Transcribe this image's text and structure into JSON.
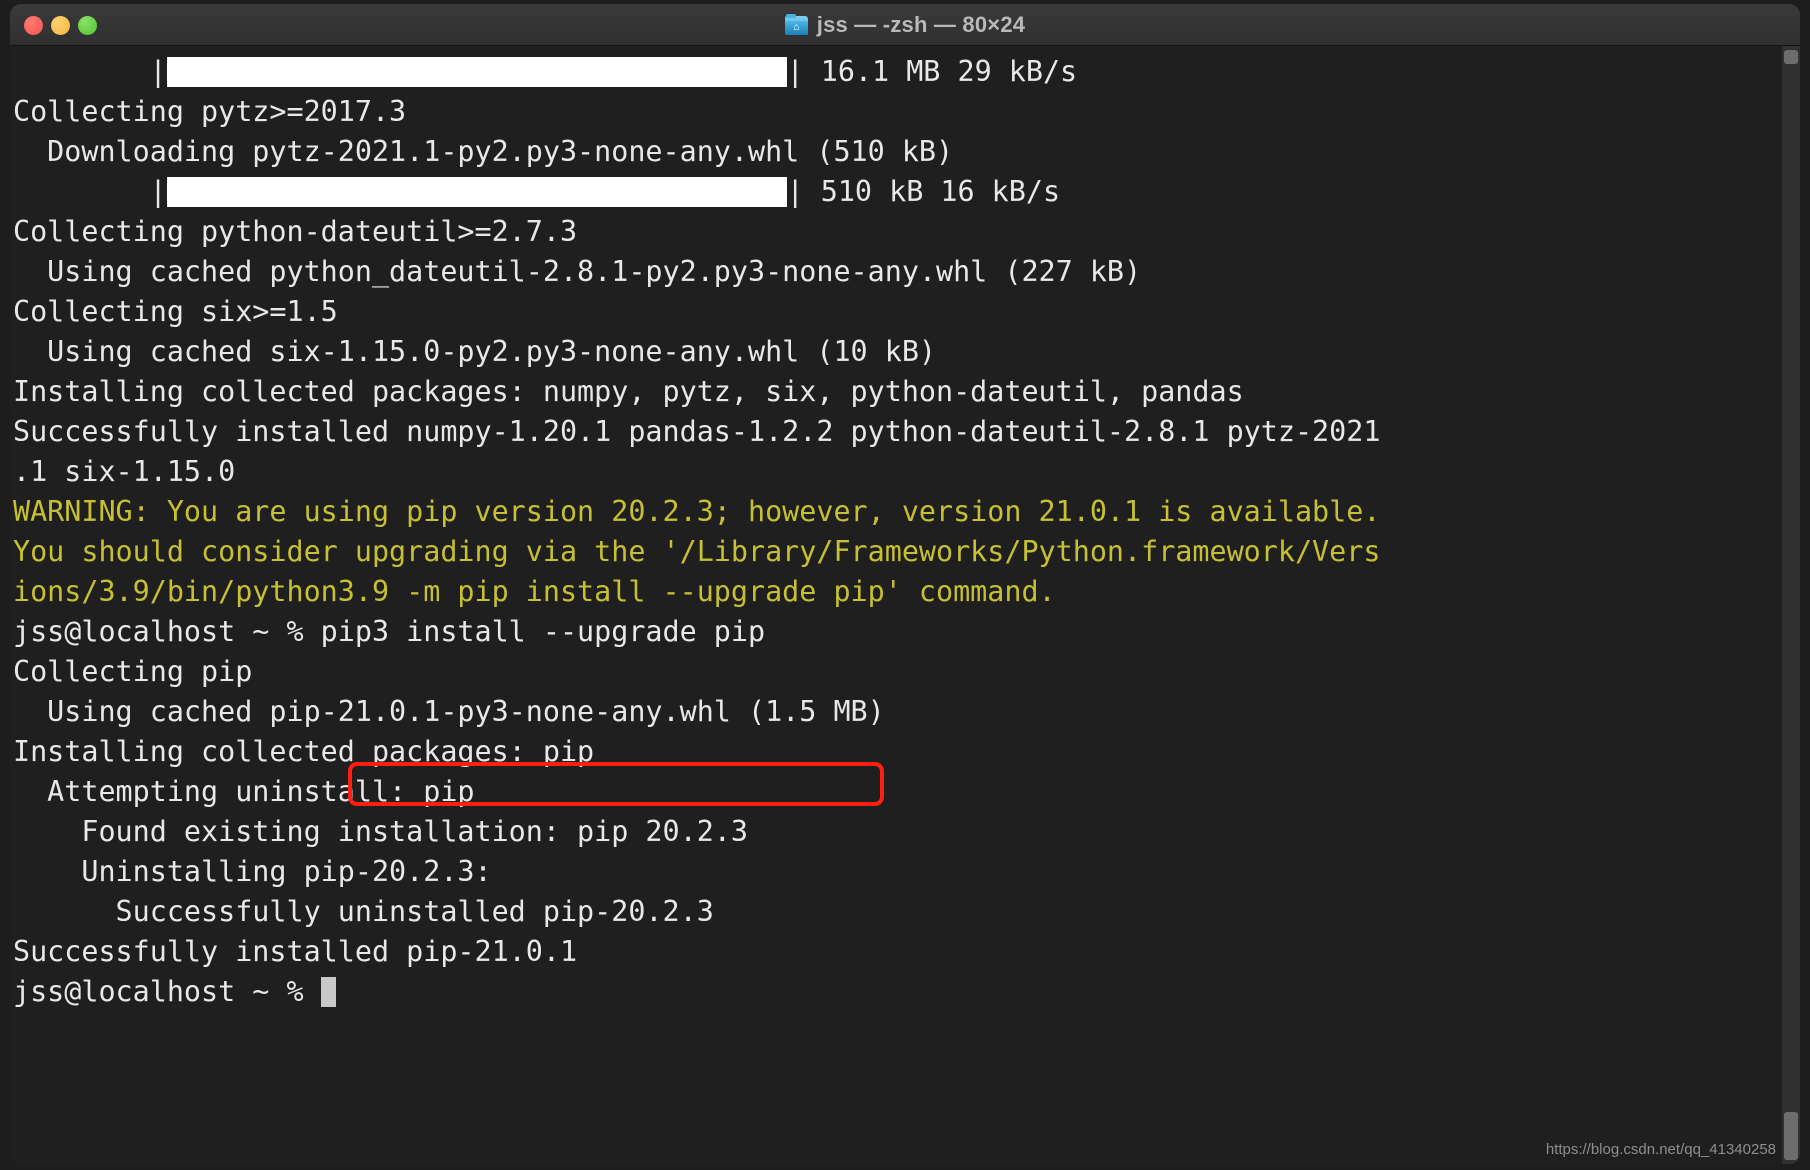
{
  "window": {
    "title": "jss — -zsh — 80×24",
    "icon": "folder-home-icon",
    "traffic_lights": [
      "close-red",
      "minimize-yellow",
      "maximize-green"
    ],
    "colors": {
      "titlebar_bg": "#343434",
      "terminal_bg": "#1f1f1f",
      "text": "#e8e8e8",
      "warning": "#c6c032",
      "highlight_box": "#ff1f12",
      "progress_fill": "#ffffff"
    }
  },
  "terminal": {
    "shell": "-zsh",
    "size": "80x24",
    "prompt": "jss@localhost ~ %",
    "lines": [
      {
        "type": "progress",
        "indent": 8,
        "fill_width": 620,
        "stat": " 16.1 MB 29 kB/s"
      },
      {
        "type": "text",
        "text": "Collecting pytz>=2017.3"
      },
      {
        "type": "text",
        "text": "  Downloading pytz-2021.1-py2.py3-none-any.whl (510 kB)"
      },
      {
        "type": "progress",
        "indent": 8,
        "fill_width": 620,
        "stat": " 510 kB 16 kB/s"
      },
      {
        "type": "text",
        "text": "Collecting python-dateutil>=2.7.3"
      },
      {
        "type": "text",
        "text": "  Using cached python_dateutil-2.8.1-py2.py3-none-any.whl (227 kB)"
      },
      {
        "type": "text",
        "text": "Collecting six>=1.5"
      },
      {
        "type": "text",
        "text": "  Using cached six-1.15.0-py2.py3-none-any.whl (10 kB)"
      },
      {
        "type": "text",
        "text": "Installing collected packages: numpy, pytz, six, python-dateutil, pandas"
      },
      {
        "type": "text",
        "text": "Successfully installed numpy-1.20.1 pandas-1.2.2 python-dateutil-2.8.1 pytz-2021"
      },
      {
        "type": "text",
        "text": ".1 six-1.15.0"
      },
      {
        "type": "warn",
        "text": "WARNING: You are using pip version 20.2.3; however, version 21.0.1 is available."
      },
      {
        "type": "warn",
        "text": "You should consider upgrading via the '/Library/Frameworks/Python.framework/Vers"
      },
      {
        "type": "warn",
        "text": "ions/3.9/bin/python3.9 -m pip install --upgrade pip' command."
      },
      {
        "type": "text",
        "text": "jss@localhost ~ % pip3 install --upgrade pip"
      },
      {
        "type": "text",
        "text": "Collecting pip"
      },
      {
        "type": "text",
        "text": "  Using cached pip-21.0.1-py3-none-any.whl (1.5 MB)"
      },
      {
        "type": "text",
        "text": "Installing collected packages: pip"
      },
      {
        "type": "text",
        "text": "  Attempting uninstall: pip"
      },
      {
        "type": "text",
        "text": "    Found existing installation: pip 20.2.3"
      },
      {
        "type": "text",
        "text": "    Uninstalling pip-20.2.3:"
      },
      {
        "type": "text",
        "text": "      Successfully uninstalled pip-20.2.3"
      },
      {
        "type": "text",
        "text": "Successfully installed pip-21.0.1"
      },
      {
        "type": "prompt",
        "text": "jss@localhost ~ % "
      }
    ],
    "highlighted_command": "pip3 install --upgrade pip"
  },
  "watermark": "https://blog.csdn.net/qq_41340258"
}
